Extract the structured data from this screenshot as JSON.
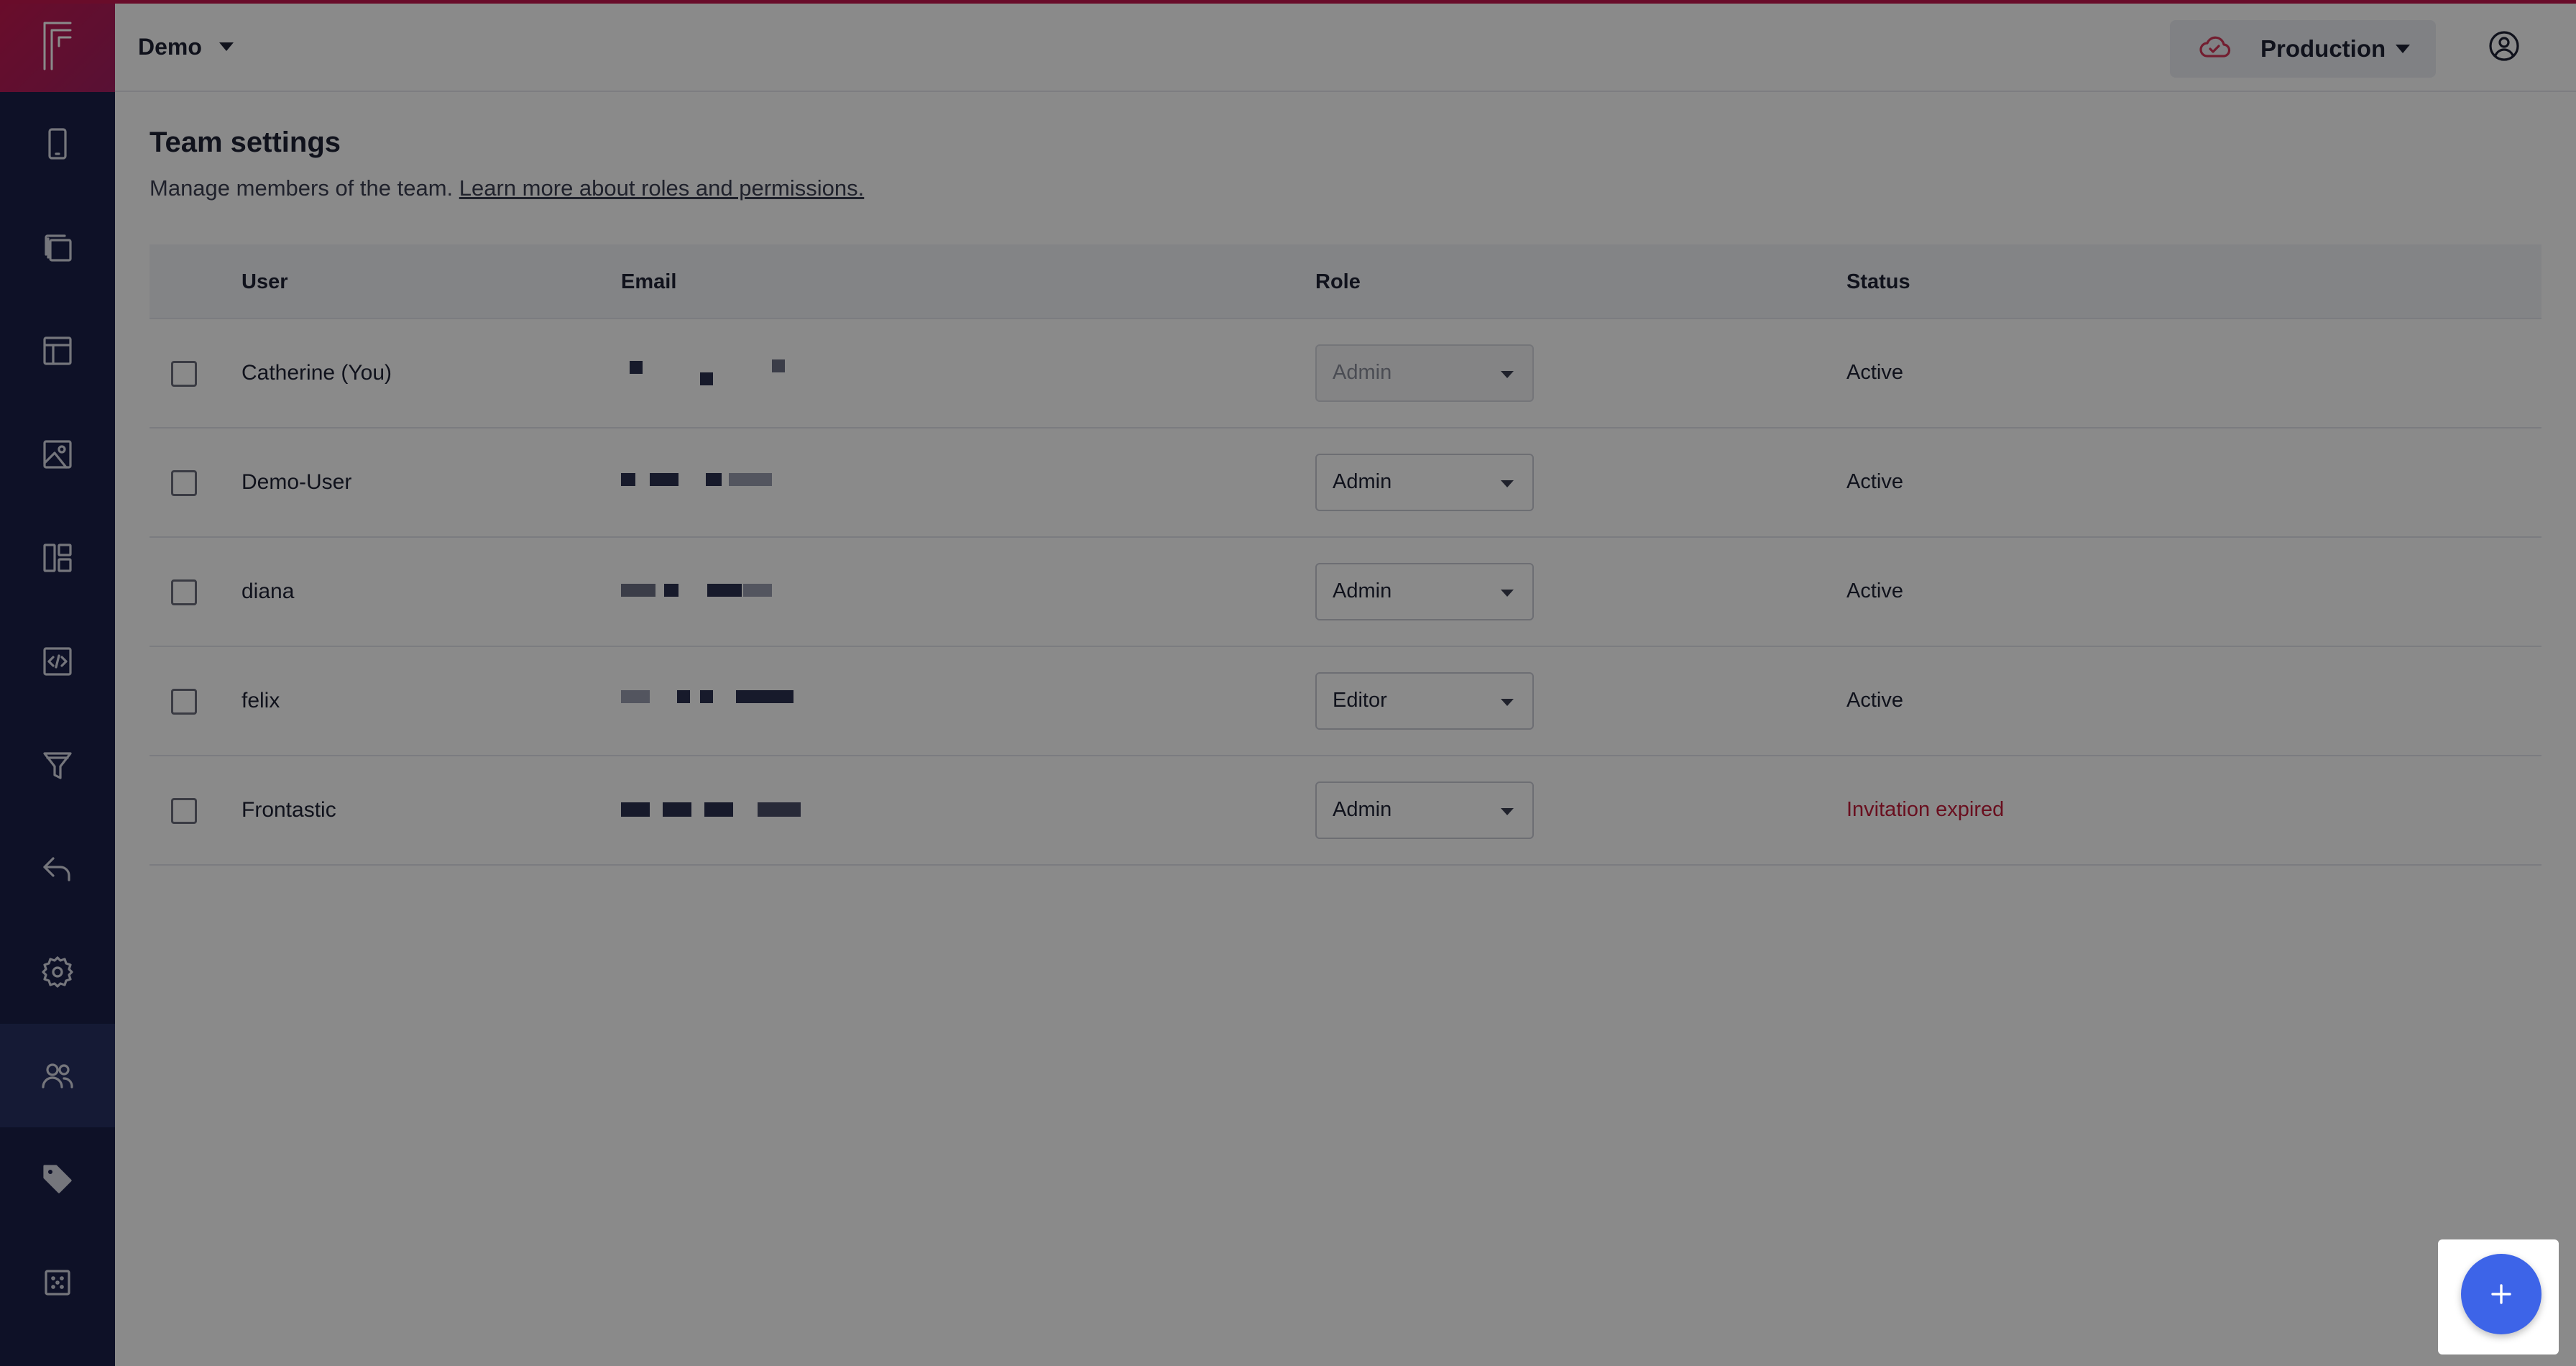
{
  "header": {
    "project": "Demo",
    "environment": "Production",
    "icons": {
      "environment": "cloud-icon",
      "account": "user-circle-icon"
    }
  },
  "sidebar": {
    "logo": "F",
    "items": [
      {
        "name": "mobile-icon"
      },
      {
        "name": "pages-icon"
      },
      {
        "name": "layout-icon"
      },
      {
        "name": "image-icon"
      },
      {
        "name": "dashboard-icon"
      },
      {
        "name": "code-icon"
      },
      {
        "name": "filter-icon"
      },
      {
        "name": "undo-icon"
      },
      {
        "name": "settings-icon"
      },
      {
        "name": "team-icon",
        "active": true
      },
      {
        "name": "tag-icon"
      },
      {
        "name": "grid-icon"
      }
    ]
  },
  "page": {
    "title": "Team settings",
    "subtitle": "Manage members of the team.",
    "link": "Learn more about roles and permissions."
  },
  "table": {
    "headers": {
      "user": "User",
      "email": "Email",
      "role": "Role",
      "status": "Status"
    },
    "rows": [
      {
        "user": "Catherine (You)",
        "role": "Admin",
        "status": "Active",
        "role_disabled": true
      },
      {
        "user": "Demo-User",
        "role": "Admin",
        "status": "Active"
      },
      {
        "user": "diana",
        "role": "Admin",
        "status": "Active"
      },
      {
        "user": "felix",
        "role": "Editor",
        "status": "Active"
      },
      {
        "user": "Frontastic",
        "role": "Admin",
        "status": "Invitation expired",
        "status_color": "#c21d3a"
      }
    ]
  },
  "fab": {
    "icon": "plus-icon"
  },
  "colors": {
    "accent": "#3d64e8",
    "brand": "#c3174f",
    "sidebar": "#1b2148",
    "error": "#c21d3a"
  }
}
